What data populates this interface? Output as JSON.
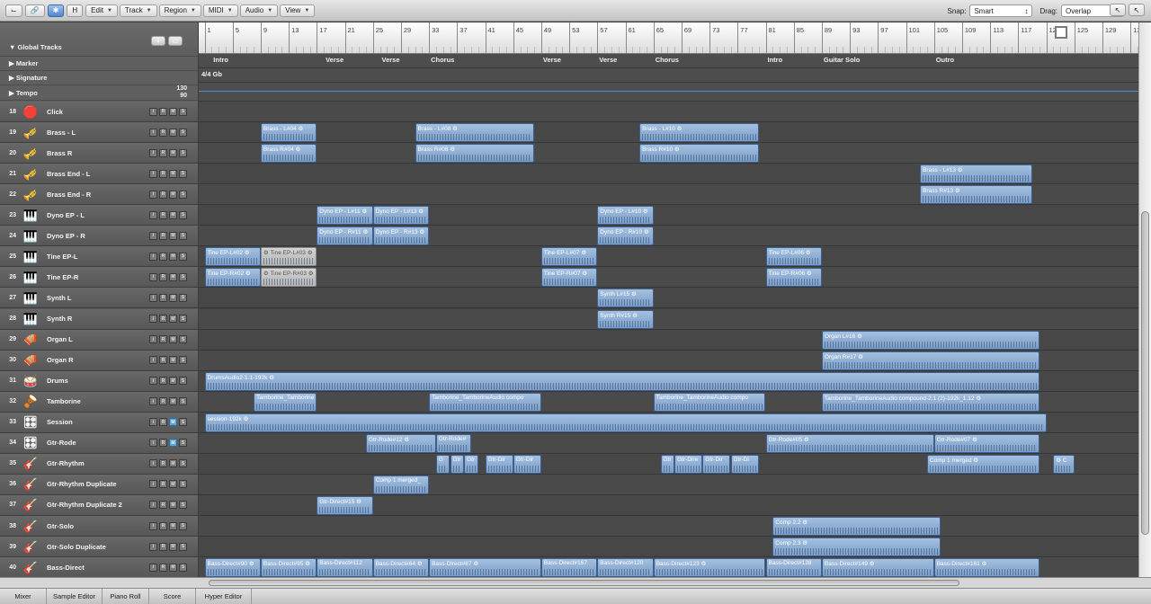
{
  "toolbar": {
    "buttons": [
      "⌙",
      "🔗",
      "✱",
      "H"
    ],
    "menus": [
      "Edit",
      "Track",
      "Region",
      "MIDI",
      "Audio",
      "View"
    ],
    "snap_label": "Snap:",
    "snap_value": "Smart",
    "drag_label": "Drag:",
    "drag_value": "Overlap",
    "tool_icons": [
      "↖",
      "↖"
    ]
  },
  "global_tracks": {
    "title": "Global Tracks",
    "rows": [
      "Marker",
      "Signature",
      "Tempo"
    ],
    "tempo_values": [
      "130",
      "90"
    ],
    "add_label": "+"
  },
  "ruler": {
    "bars": [
      "1",
      "5",
      "9",
      "13",
      "17",
      "21",
      "25",
      "29",
      "33",
      "37",
      "41",
      "45",
      "49",
      "53",
      "57",
      "61",
      "65",
      "69",
      "73",
      "77",
      "81",
      "85",
      "89",
      "93",
      "97",
      "101",
      "105",
      "109",
      "113",
      "117",
      "121",
      "125",
      "129",
      "13"
    ]
  },
  "markers": [
    "Intro",
    "Verse",
    "Verse",
    "Chorus",
    "Verse",
    "Verse",
    "Chorus",
    "Intro",
    "Guitar Solo",
    "Outro"
  ],
  "signature": "4/4  Gb",
  "tracks": [
    {
      "num": "18",
      "name": "Click",
      "icon": "🛑"
    },
    {
      "num": "19",
      "name": "Brass - L",
      "icon": "🎺"
    },
    {
      "num": "20",
      "name": "Brass R",
      "icon": "🎺"
    },
    {
      "num": "21",
      "name": "Brass End - L",
      "icon": "🎺"
    },
    {
      "num": "22",
      "name": "Brass End - R",
      "icon": "🎺"
    },
    {
      "num": "23",
      "name": "Dyno EP - L",
      "icon": "🎹"
    },
    {
      "num": "24",
      "name": "Dyno EP - R",
      "icon": "🎹"
    },
    {
      "num": "25",
      "name": "Tine EP-L",
      "icon": "🎹"
    },
    {
      "num": "26",
      "name": "Tine EP-R",
      "icon": "🎹"
    },
    {
      "num": "27",
      "name": "Synth L",
      "icon": "🎹"
    },
    {
      "num": "28",
      "name": "Synth R",
      "icon": "🎹"
    },
    {
      "num": "29",
      "name": "Organ L",
      "icon": "🪗"
    },
    {
      "num": "30",
      "name": "Organ R",
      "icon": "🪗"
    },
    {
      "num": "31",
      "name": "Drums",
      "icon": "🥁"
    },
    {
      "num": "32",
      "name": "Tamborine",
      "icon": "🪘"
    },
    {
      "num": "33",
      "name": "Session",
      "icon": "🎛"
    },
    {
      "num": "34",
      "name": "Gtr-Rode",
      "icon": "🎛"
    },
    {
      "num": "35",
      "name": "Gtr-Rhythm",
      "icon": "🎸"
    },
    {
      "num": "36",
      "name": "Gtr-Rhythm Duplicate",
      "icon": "🎸"
    },
    {
      "num": "37",
      "name": "Gtr-Rhythm Duplicate 2",
      "icon": "🎸"
    },
    {
      "num": "38",
      "name": "Gtr-Solo",
      "icon": "🎸"
    },
    {
      "num": "39",
      "name": "Gtr-Solo Duplicate",
      "icon": "🎸"
    },
    {
      "num": "40",
      "name": "Bass-Direct",
      "icon": "🎸"
    }
  ],
  "track_buttons": [
    "i",
    "R",
    "M",
    "S"
  ],
  "regions": [
    {
      "row": 1,
      "bar": 9,
      "len": 8,
      "label": "Brass - L#04 ⚙"
    },
    {
      "row": 1,
      "bar": 31,
      "len": 17,
      "label": "Brass - L#08 ⚙"
    },
    {
      "row": 1,
      "bar": 63,
      "len": 17,
      "label": "Brass - L#10 ⚙"
    },
    {
      "row": 2,
      "bar": 9,
      "len": 8,
      "label": "Brass R#04 ⚙"
    },
    {
      "row": 2,
      "bar": 31,
      "len": 17,
      "label": "Brass R#08 ⚙"
    },
    {
      "row": 2,
      "bar": 63,
      "len": 17,
      "label": "Brass R#10 ⚙"
    },
    {
      "row": 3,
      "bar": 103,
      "len": 16,
      "label": "Brass - L#13 ⚙"
    },
    {
      "row": 4,
      "bar": 103,
      "len": 16,
      "label": "Brass R#13 ⚙"
    },
    {
      "row": 5,
      "bar": 17,
      "len": 8,
      "label": "Dyno EP - L#11 ⚙"
    },
    {
      "row": 5,
      "bar": 25,
      "len": 8,
      "label": "Dyno EP - L#13 ⚙"
    },
    {
      "row": 5,
      "bar": 57,
      "len": 8,
      "label": "Dyno EP - L#10 ⚙"
    },
    {
      "row": 6,
      "bar": 17,
      "len": 8,
      "label": "Dyno EP - R#11 ⚙"
    },
    {
      "row": 6,
      "bar": 25,
      "len": 8,
      "label": "Dyno EP - R#13 ⚙"
    },
    {
      "row": 6,
      "bar": 57,
      "len": 8,
      "label": "Dyno EP - R#10 ⚙"
    },
    {
      "row": 7,
      "bar": 1,
      "len": 8,
      "label": "Tine EP-L#02 ⚙"
    },
    {
      "row": 7,
      "bar": 9,
      "len": 8,
      "label": "⚙ Tine EP-L#03 ⚙",
      "muted": true
    },
    {
      "row": 7,
      "bar": 49,
      "len": 8,
      "label": "Tine EP-L#07 ⚙"
    },
    {
      "row": 7,
      "bar": 81,
      "len": 8,
      "label": "Tine EP-L#06 ⚙"
    },
    {
      "row": 8,
      "bar": 1,
      "len": 8,
      "label": "Tine EP-R#02 ⚙"
    },
    {
      "row": 8,
      "bar": 9,
      "len": 8,
      "label": "⚙ Tine EP-R#03 ⚙",
      "muted": true
    },
    {
      "row": 8,
      "bar": 49,
      "len": 8,
      "label": "Tine EP-R#07 ⚙"
    },
    {
      "row": 8,
      "bar": 81,
      "len": 8,
      "label": "Tine EP-R#06 ⚙"
    },
    {
      "row": 9,
      "bar": 57,
      "len": 8,
      "label": "Synth L#15 ⚙"
    },
    {
      "row": 10,
      "bar": 57,
      "len": 8,
      "label": "Synth R#15 ⚙"
    },
    {
      "row": 11,
      "bar": 89,
      "len": 31,
      "label": "Organ L#16 ⚙"
    },
    {
      "row": 12,
      "bar": 89,
      "len": 31,
      "label": "Organ R#17 ⚙"
    },
    {
      "row": 13,
      "bar": 1,
      "len": 119,
      "label": "DrumsAudio2-1.1-192k ⚙"
    },
    {
      "row": 14,
      "bar": 8,
      "len": 9,
      "label": "Tamborine_Tamborine"
    },
    {
      "row": 14,
      "bar": 33,
      "len": 16,
      "label": "Tamborine_TamborineAudio compo"
    },
    {
      "row": 14,
      "bar": 65,
      "len": 16,
      "label": "Tamborine_TamborineAudio compo"
    },
    {
      "row": 14,
      "bar": 89,
      "len": 31,
      "label": "Tamborine_TamborineAudio compound-2.1 (2)-192k_1.12 ⚙"
    },
    {
      "row": 15,
      "bar": 0,
      "len": 120,
      "label": "session-192k ⚙"
    },
    {
      "row": 16,
      "bar": 24,
      "len": 10,
      "label": "Gtr-Rode#12 ⚙"
    },
    {
      "row": 16,
      "bar": 34,
      "len": 5,
      "label": "Gtr-Rode#"
    },
    {
      "row": 16,
      "bar": 81,
      "len": 24,
      "label": "Gtr-Rode#05 ⚙"
    },
    {
      "row": 16,
      "bar": 105,
      "len": 15,
      "label": "Gtr-Rode#07 ⚙"
    },
    {
      "row": 17,
      "bar": 34,
      "len": 2,
      "label": "G"
    },
    {
      "row": 17,
      "bar": 36,
      "len": 2,
      "label": "Gtr"
    },
    {
      "row": 17,
      "bar": 38,
      "len": 2,
      "label": "Gtr"
    },
    {
      "row": 17,
      "bar": 41,
      "len": 4,
      "label": "Gtr-Dir"
    },
    {
      "row": 17,
      "bar": 45,
      "len": 4,
      "label": "Gtr-Dir"
    },
    {
      "row": 17,
      "bar": 66,
      "len": 2,
      "label": "Gtr"
    },
    {
      "row": 17,
      "bar": 68,
      "len": 4,
      "label": "Gtr-Dire"
    },
    {
      "row": 17,
      "bar": 72,
      "len": 4,
      "label": "Gtr-Dir"
    },
    {
      "row": 17,
      "bar": 76,
      "len": 4,
      "label": "Gtr-Di"
    },
    {
      "row": 17,
      "bar": 104,
      "len": 16,
      "label": "Comp 1 merged ⚙"
    },
    {
      "row": 17,
      "bar": 122,
      "len": 3,
      "label": "⚙ C"
    },
    {
      "row": 18,
      "bar": 25,
      "len": 8,
      "label": "Comp 1 merged_"
    },
    {
      "row": 19,
      "bar": 17,
      "len": 8,
      "label": "Gtr-Direct#15 ⚙"
    },
    {
      "row": 20,
      "bar": 82,
      "len": 24,
      "label": "Comp 2.2 ⚙"
    },
    {
      "row": 21,
      "bar": 82,
      "len": 24,
      "label": "Comp 2.3 ⚙"
    },
    {
      "row": 22,
      "bar": 1,
      "len": 8,
      "label": "Bass-Direct#90 ⚙"
    },
    {
      "row": 22,
      "bar": 9,
      "len": 8,
      "label": "Bass-Direct#95 ⚙"
    },
    {
      "row": 22,
      "bar": 17,
      "len": 8,
      "label": "Bass-Direct#112"
    },
    {
      "row": 22,
      "bar": 25,
      "len": 8,
      "label": "Bass-Direct#64 ⚙"
    },
    {
      "row": 22,
      "bar": 33,
      "len": 16,
      "label": "Bass-Direct#87 ⚙"
    },
    {
      "row": 22,
      "bar": 49,
      "len": 8,
      "label": "Bass-Direct#167"
    },
    {
      "row": 22,
      "bar": 57,
      "len": 8,
      "label": "Bass-Direct#120"
    },
    {
      "row": 22,
      "bar": 65,
      "len": 16,
      "label": "Bass-Direct#123 ⚙"
    },
    {
      "row": 22,
      "bar": 81,
      "len": 8,
      "label": "Bass-Direct#128"
    },
    {
      "row": 22,
      "bar": 89,
      "len": 16,
      "label": "Bass-Direct#149 ⚙"
    },
    {
      "row": 22,
      "bar": 105,
      "len": 15,
      "label": "Bass-Direct#161 ⚙"
    }
  ],
  "bottom_tabs": [
    "Mixer",
    "Sample Editor",
    "Piano Roll",
    "Score",
    "Hyper Editor"
  ],
  "colors": {
    "region": "#8fb0d6",
    "region_border": "#3c5f8e",
    "tempo_line": "#4a8fd6",
    "track_bg": "#5f5f5f"
  }
}
